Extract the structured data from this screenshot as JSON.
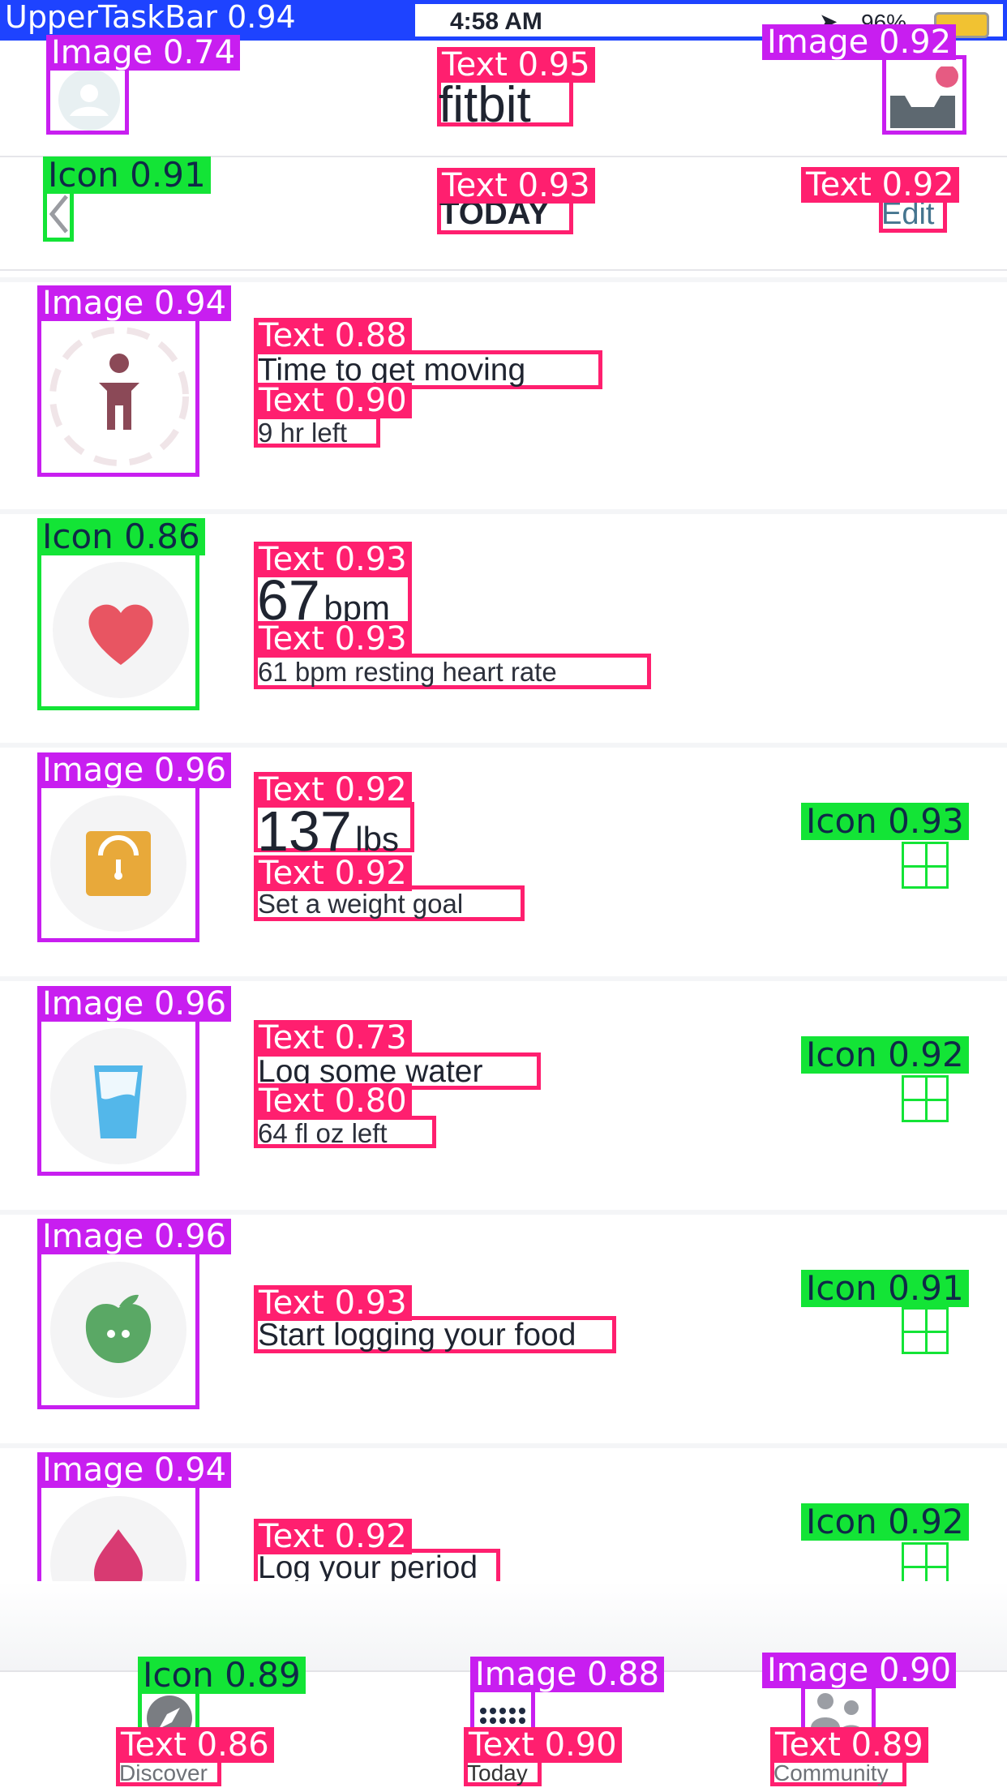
{
  "status_bar": {
    "time": "4:58 AM",
    "battery": "96%",
    "detection_label": "UpperTaskBar 0.94"
  },
  "header": {
    "brand": "fitbit",
    "date": "TODAY",
    "edit": "Edit",
    "labels": {
      "left_image": "Image 0.74",
      "brand_text": "Text 0.95",
      "right_image": "Image 0.92",
      "back_icon": "Icon 0.91",
      "date_text": "Text 0.93",
      "edit_text": "Text 0.92"
    }
  },
  "rows": [
    {
      "title": "Time to get moving",
      "sub": "9 hr left",
      "labels": {
        "media": "Image 0.94",
        "title": "Text 0.88",
        "sub": "Text 0.90"
      }
    },
    {
      "value": "67",
      "unit": "bpm",
      "sub": "61 bpm resting heart rate",
      "labels": {
        "media": "Icon 0.86",
        "title": "Text 0.93",
        "sub": "Text 0.93"
      }
    },
    {
      "value": "137",
      "unit": "lbs",
      "sub": "Set a weight goal",
      "labels": {
        "media": "Image 0.96",
        "title": "Text 0.92",
        "sub": "Text 0.92",
        "plus": "Icon 0.93"
      }
    },
    {
      "title": "Log some water",
      "sub": "64 fl oz left",
      "labels": {
        "media": "Image 0.96",
        "title": "Text 0.73",
        "sub": "Text 0.80",
        "plus": "Icon 0.92"
      }
    },
    {
      "title": "Start logging your food",
      "labels": {
        "media": "Image 0.96",
        "title": "Text 0.93",
        "plus": "Icon 0.91"
      }
    },
    {
      "title": "Log your period",
      "labels": {
        "media": "Image 0.94",
        "title": "Text 0.92",
        "plus": "Icon 0.92"
      }
    }
  ],
  "bottom_nav": {
    "discover": "Discover",
    "today": "Today",
    "community": "Community",
    "labels": {
      "discover_icon": "Icon 0.89",
      "discover_text": "Text 0.86",
      "today_image": "Image 0.88",
      "today_text": "Text 0.90",
      "community_image": "Image 0.90",
      "community_text": "Text 0.89"
    }
  },
  "colors": {
    "pink": "#ff1f6f",
    "purple": "#c81ef0",
    "green": "#13e436",
    "heart": "#e85562",
    "scale": "#e8a93a",
    "water": "#53b7ea",
    "food": "#5aa865",
    "period": "#d83a72"
  }
}
